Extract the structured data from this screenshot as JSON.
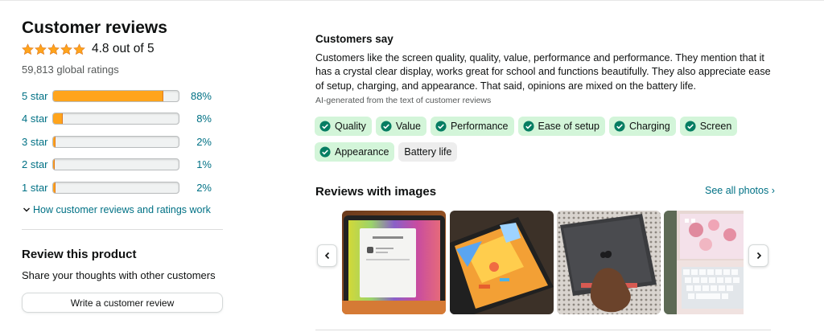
{
  "summary": {
    "title": "Customer reviews",
    "rating_text": "4.8 out of 5",
    "global_ratings": "59,813 global ratings"
  },
  "histogram": [
    {
      "label": "5 star",
      "percent_text": "88%",
      "fill": 0.88
    },
    {
      "label": "4 star",
      "percent_text": "8%",
      "fill": 0.08
    },
    {
      "label": "3 star",
      "percent_text": "2%",
      "fill": 0.02
    },
    {
      "label": "2 star",
      "percent_text": "1%",
      "fill": 0.01
    },
    {
      "label": "1 star",
      "percent_text": "2%",
      "fill": 0.02
    }
  ],
  "how_link": "How customer reviews and ratings work",
  "review_product": {
    "title": "Review this product",
    "subtitle": "Share your thoughts with other customers",
    "button": "Write a customer review"
  },
  "customers_say": {
    "title": "Customers say",
    "body": "Customers like the screen quality, quality, value, performance and performance. They mention that it has a crystal clear display, works great for school and functions beautifully. They also appreciate ease of setup, charging, and appearance. That said, opinions are mixed on the battery life.",
    "ai_note": "AI-generated from the text of customer reviews",
    "aspects": [
      {
        "label": "Quality",
        "sentiment": "positive"
      },
      {
        "label": "Value",
        "sentiment": "positive"
      },
      {
        "label": "Performance",
        "sentiment": "positive"
      },
      {
        "label": "Ease of setup",
        "sentiment": "positive"
      },
      {
        "label": "Charging",
        "sentiment": "positive"
      },
      {
        "label": "Screen",
        "sentiment": "positive"
      },
      {
        "label": "Appearance",
        "sentiment": "positive"
      },
      {
        "label": "Battery life",
        "sentiment": "mixed"
      }
    ]
  },
  "reviews_with_images": {
    "title": "Reviews with images",
    "see_all": "See all photos ›",
    "photos": [
      {
        "name": "tablet-software-update-photo"
      },
      {
        "name": "tablet-game-screen-photo"
      },
      {
        "name": "tablet-back-hand-photo"
      },
      {
        "name": "tablet-keyboard-case-photo"
      }
    ]
  },
  "colors": {
    "star": "#ffa41c",
    "link": "#007185",
    "chip_positive": "#d3f5d9",
    "chip_mixed": "#ededed",
    "check": "#067d62"
  },
  "icons": [
    "star-icon",
    "chevron-down-icon",
    "check-circle-icon",
    "chevron-left-icon",
    "chevron-right-icon"
  ]
}
